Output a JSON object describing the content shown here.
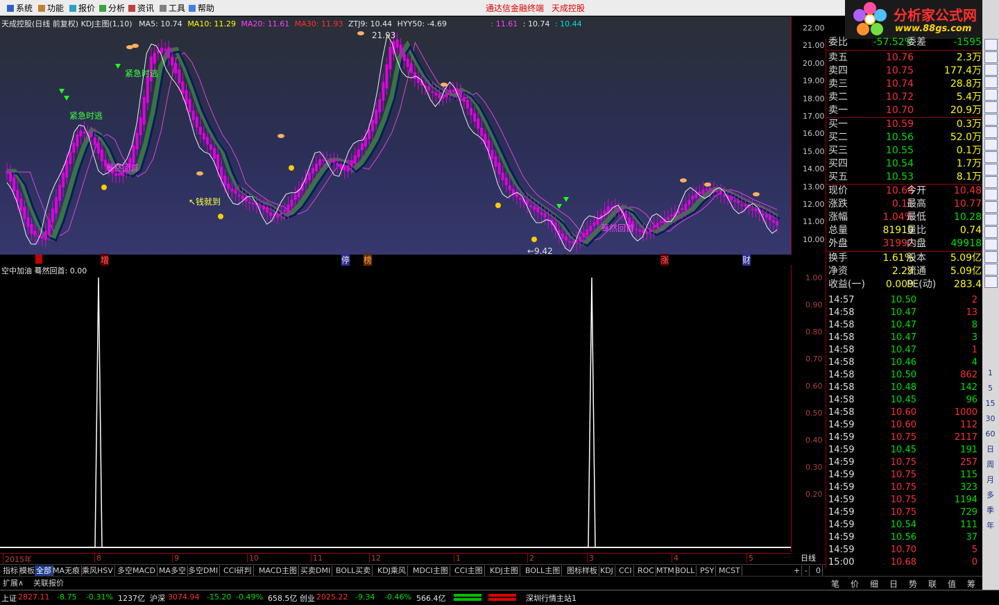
{
  "menu": {
    "items": [
      "系统",
      "功能",
      "报价",
      "分析",
      "资讯",
      "工具",
      "帮助"
    ],
    "title_left": "通达信金融终端",
    "title_right": "天成控股",
    "right_button": "行"
  },
  "logo": {
    "text": "分析家公式网",
    "url_text": "www.88gs.com"
  },
  "main_info": {
    "stock": "天成控股(日线 前复权) KDJ主图(1,10)",
    "ma5": "MA5: 10.74",
    "ma10": "MA10: 11.29",
    "ma20": "MA20: 11.61",
    "ma30": "MA30: 11.93",
    "ztj9": "ZTJ9: 10.44",
    "hyy50": "HYY50: -4.69",
    "extra1": ": 11.61",
    "extra2": ": 10.74",
    "extra3": ": 10.44"
  },
  "main_axis": [
    "22.00",
    "21.00",
    "20.00",
    "19.00",
    "18.00",
    "17.00",
    "16.00",
    "15.00",
    "14.00",
    "13.00",
    "12.00",
    "11.00",
    "10.00"
  ],
  "annotations": {
    "high": "21.93",
    "low": "←9.42",
    "labels": [
      "紧急时逃",
      "紧急时逃",
      "蓦然回首",
      "↖钱就到",
      "蓦然回首"
    ]
  },
  "event_strip": [
    "增",
    "停",
    "榜",
    "涨",
    "财"
  ],
  "sub_info": "空中加油  蓦然回首: 0.00",
  "sub_axis": [
    "1.00",
    "0.90",
    "0.80",
    "0.70",
    "0.60",
    "0.50",
    "0.40",
    "0.30",
    "0.20"
  ],
  "time_axis": [
    "2015年",
    "8",
    "9",
    "10",
    "11",
    "12",
    "1",
    "2",
    "3",
    "4",
    "5"
  ],
  "period_button": "日线",
  "tabs": [
    "指标",
    "模板",
    "全部",
    "MA无痕",
    "乘风HSV",
    "多空MACD",
    "MA多空",
    "多空DMI",
    "CCI研判",
    "MACD主图",
    "买卖DMI",
    "BOLL买卖",
    "KDJ乘风",
    "MDCI主图",
    "CCI主图",
    "KDJ主图",
    "BOLL主图",
    "图标样板",
    "KDJ",
    "CCI",
    "ROC",
    "MTM",
    "BOLL",
    "PSY",
    "MCST"
  ],
  "tab_controls": [
    "+",
    "-",
    "0"
  ],
  "sub_tabs": [
    "扩展∧",
    "关联报价"
  ],
  "status": {
    "sh_label": "上证",
    "sh_value": "2827.11",
    "sh_change": "-8.75",
    "sh_pct": "-0.31%",
    "sh_amount": "1237亿",
    "sz_label": "沪深",
    "sz_value": "3074.94",
    "sz_change": "-15.20",
    "sz_pct": "-0.49%",
    "sz_amount": "658.5亿",
    "cy_label": "创业",
    "cy_value": "2025.22",
    "cy_change": "-9.34",
    "cy_pct": "-0.46%",
    "cy_amount": "566.4亿",
    "server": "深圳行情主站1"
  },
  "quote": {
    "weibi": {
      "label": "委比",
      "value": "-57.52%",
      "label2": "委差",
      "value2": "-1595"
    },
    "asks": [
      {
        "label": "卖五",
        "price": "10.76",
        "vol": "2.3万"
      },
      {
        "label": "卖四",
        "price": "10.75",
        "vol": "177.4万"
      },
      {
        "label": "卖三",
        "price": "10.74",
        "vol": "28.8万"
      },
      {
        "label": "卖二",
        "price": "10.72",
        "vol": "5.4万"
      },
      {
        "label": "卖一",
        "price": "10.70",
        "vol": "20.9万"
      }
    ],
    "bids": [
      {
        "label": "买一",
        "price": "10.59",
        "vol": "0.3万"
      },
      {
        "label": "买二",
        "price": "10.56",
        "vol": "52.0万"
      },
      {
        "label": "买三",
        "price": "10.55",
        "vol": "0.1万"
      },
      {
        "label": "买四",
        "price": "10.54",
        "vol": "1.7万"
      },
      {
        "label": "买五",
        "price": "10.53",
        "vol": "8.1万"
      }
    ],
    "stats": [
      {
        "l1": "现价",
        "v1": "10.68",
        "l2": "今开",
        "v2": "10.48"
      },
      {
        "l1": "涨跌",
        "v1": "0.11",
        "l2": "最高",
        "v2": "10.77"
      },
      {
        "l1": "涨幅",
        "v1": "1.04%",
        "l2": "最低",
        "v2": "10.28"
      },
      {
        "l1": "总量",
        "v1": "81910",
        "l2": "量比",
        "v2": "0.74"
      },
      {
        "l1": "外盘",
        "v1": "31992",
        "l2": "内盘",
        "v2": "49918"
      }
    ],
    "stats2": [
      {
        "l1": "换手",
        "v1": "1.61%",
        "l2": "股本",
        "v2": "5.09亿"
      },
      {
        "l1": "净资",
        "v1": "2.29",
        "l2": "流通",
        "v2": "5.09亿"
      },
      {
        "l1": "收益(一)",
        "v1": "0.009",
        "l2": "PE(动)",
        "v2": "283.4"
      }
    ]
  },
  "ticks": [
    {
      "t": "14:57",
      "p": "10.50",
      "v": "2",
      "c": "green",
      "vc": "red"
    },
    {
      "t": "14:58",
      "p": "10.47",
      "v": "13",
      "c": "green",
      "vc": "red"
    },
    {
      "t": "14:58",
      "p": "10.47",
      "v": "8",
      "c": "green",
      "vc": "green"
    },
    {
      "t": "14:58",
      "p": "10.47",
      "v": "3",
      "c": "green",
      "vc": "green"
    },
    {
      "t": "14:58",
      "p": "10.47",
      "v": "1",
      "c": "green",
      "vc": "red"
    },
    {
      "t": "14:58",
      "p": "10.46",
      "v": "4",
      "c": "green",
      "vc": "green"
    },
    {
      "t": "14:58",
      "p": "10.50",
      "v": "862",
      "c": "green",
      "vc": "red"
    },
    {
      "t": "14:58",
      "p": "10.48",
      "v": "142",
      "c": "green",
      "vc": "green"
    },
    {
      "t": "14:58",
      "p": "10.45",
      "v": "96",
      "c": "green",
      "vc": "green"
    },
    {
      "t": "14:58",
      "p": "10.60",
      "v": "1000",
      "c": "red",
      "vc": "red"
    },
    {
      "t": "14:59",
      "p": "10.60",
      "v": "112",
      "c": "red",
      "vc": "red"
    },
    {
      "t": "14:59",
      "p": "10.75",
      "v": "2117",
      "c": "red",
      "vc": "red"
    },
    {
      "t": "14:59",
      "p": "10.45",
      "v": "191",
      "c": "green",
      "vc": "green"
    },
    {
      "t": "14:59",
      "p": "10.75",
      "v": "257",
      "c": "red",
      "vc": "red"
    },
    {
      "t": "14:59",
      "p": "10.75",
      "v": "115",
      "c": "red",
      "vc": "green"
    },
    {
      "t": "14:59",
      "p": "10.75",
      "v": "323",
      "c": "red",
      "vc": "green"
    },
    {
      "t": "14:59",
      "p": "10.75",
      "v": "1194",
      "c": "red",
      "vc": "green"
    },
    {
      "t": "14:59",
      "p": "10.75",
      "v": "729",
      "c": "red",
      "vc": "green"
    },
    {
      "t": "14:59",
      "p": "10.54",
      "v": "111",
      "c": "green",
      "vc": "green"
    },
    {
      "t": "14:59",
      "p": "10.56",
      "v": "37",
      "c": "green",
      "vc": "green"
    },
    {
      "t": "14:59",
      "p": "10.70",
      "v": "5",
      "c": "red",
      "vc": "red"
    },
    {
      "t": "15:00",
      "p": "10.68",
      "v": "0",
      "c": "red",
      "vc": "red"
    }
  ],
  "right_tabs": [
    "笔",
    "价",
    "细",
    "日",
    "势",
    "联",
    "值",
    "筹"
  ],
  "side_icons": [
    "1",
    "5",
    "15",
    "30",
    "60",
    "日",
    "周",
    "月",
    "多",
    "季",
    "年"
  ],
  "chart_data": {
    "type": "line",
    "title": "",
    "price_axis": {
      "min": 9.42,
      "max": 21.93
    },
    "indicator": {
      "name": "空中加油 蓦然回首",
      "ylim": [
        0,
        1
      ],
      "spikes": [
        {
          "x": "2015-08",
          "value": 1.0
        },
        {
          "x": "2016-03",
          "value": 1.0
        }
      ]
    },
    "close_path_values": [
      13.8,
      11.8,
      10.2,
      9.9,
      12.1,
      14.5,
      16.2,
      15.8,
      14.2,
      13.5,
      14.0,
      16.5,
      20.5,
      21.0,
      19.5,
      17.5,
      16.0,
      15.0,
      13.0,
      12.5,
      12.0,
      11.8,
      11.2,
      11.5,
      12.5,
      13.6,
      14.5,
      14.4,
      13.8,
      14.8,
      16.0,
      18.0,
      21.5,
      20.2,
      19.0,
      18.5,
      18.0,
      18.6,
      17.8,
      16.5,
      15.0,
      13.5,
      12.5,
      12.0,
      11.5,
      11.0,
      10.0,
      9.6,
      10.3,
      11.0,
      11.8,
      11.5,
      10.5,
      10.2,
      10.8,
      11.2,
      11.6,
      12.4,
      12.8,
      12.6,
      12.2,
      11.9,
      11.6,
      11.2,
      10.68
    ]
  }
}
